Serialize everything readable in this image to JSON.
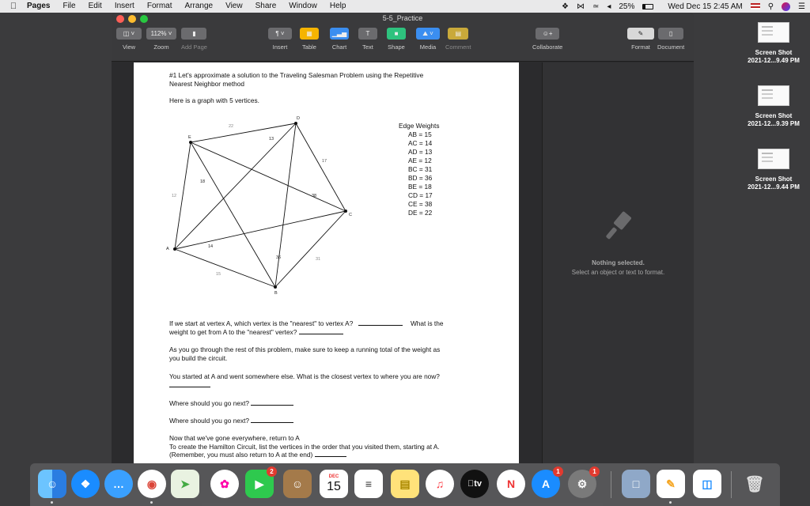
{
  "menubar": {
    "app": "Pages",
    "items": [
      "File",
      "Edit",
      "Insert",
      "Format",
      "Arrange",
      "View",
      "Share",
      "Window",
      "Help"
    ],
    "battery_percent": "25%",
    "battery_level": 0.25,
    "datetime": "Wed Dec 15  2:45 AM"
  },
  "window": {
    "title": "5-5_Practice",
    "toolbar": {
      "view_label": "View",
      "zoom_value": "112%",
      "zoom_label": "Zoom",
      "add_page_label": "Add Page",
      "insert_label": "Insert",
      "table_label": "Table",
      "chart_label": "Chart",
      "text_label": "Text",
      "shape_label": "Shape",
      "media_label": "Media",
      "comment_label": "Comment",
      "collaborate_label": "Collaborate",
      "format_label": "Format",
      "document_label": "Document"
    }
  },
  "document": {
    "q1_line1": "#1 Let's approximate a solution to the Traveling Salesman Problem using the Repetitive",
    "q1_line2": "Nearest Neighbor method",
    "intro": "Here is a graph with 5 vertices.",
    "graph": {
      "vertices": [
        "A",
        "B",
        "C",
        "D",
        "E"
      ],
      "edge_label_values": [
        "22",
        "13",
        "17",
        "18",
        "12",
        "38",
        "14",
        "36",
        "31",
        "15"
      ]
    },
    "edge_weights_title": "Edge Weights",
    "edge_weights": [
      "AB = 15",
      "AC = 14",
      "AD = 13",
      "AE = 12",
      "BC = 31",
      "BD = 36",
      "BE = 18",
      "CD = 17",
      "CE = 38",
      "DE = 22"
    ],
    "p1_a": "If we start at vertex A, which vertex is the \"nearest\" to vertex A?",
    "p1_b": "What is the",
    "p1_c": "weight to get from A to the \"nearest\" vertex?",
    "p2_a": "As you go through the rest of this problem, make sure to keep a running total of the weight as",
    "p2_b": "you build the circuit.",
    "p3": "You started at A and went somewhere else.  What is the closest vertex to where you are now?",
    "p4": "Where should you go next?",
    "p5": "Where should you go next?",
    "p6_a": "Now that we've gone everywhere,  return to A",
    "p6_b": "To create the Hamilton Circuit, list the vertices in the order that you visited them, starting at A.",
    "p6_c": "(Remember, you must also return to A at the end)"
  },
  "sidebar": {
    "nothing_selected": "Nothing selected.",
    "hint": "Select an object or text to format."
  },
  "desktop": {
    "items": [
      {
        "name": "Screen Shot",
        "detail": "2021-12...9.49 PM"
      },
      {
        "name": "Screen Shot",
        "detail": "2021-12...9.39 PM"
      },
      {
        "name": "Screen Shot",
        "detail": "2021-12...9.44 PM"
      }
    ]
  },
  "dock": {
    "facetime_badge": "2",
    "calendar_month": "DEC",
    "calendar_day": "15",
    "appstore_badge": "1",
    "prefs_badge": "1",
    "tv_label": "tv"
  },
  "colors": {
    "light_red": "#ff5f57",
    "light_yellow": "#febc2e",
    "light_green": "#28c840",
    "accent": "#3478f6"
  }
}
